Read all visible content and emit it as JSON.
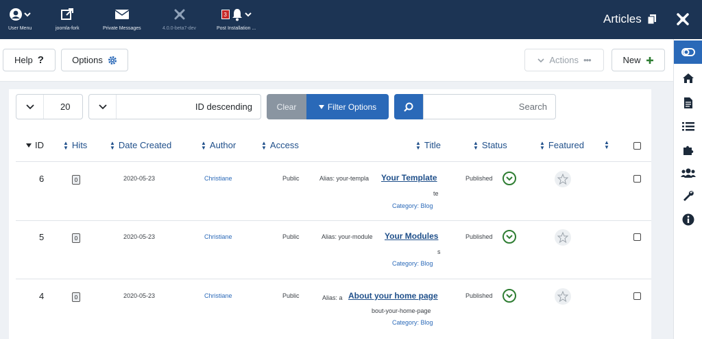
{
  "header": {
    "brand_title": "Articles",
    "items": [
      {
        "label": "User Menu",
        "icon": "user-icon"
      },
      {
        "label": "joomla-fork",
        "icon": "external-link-icon"
      },
      {
        "label": "Private Messages",
        "icon": "envelope-icon"
      },
      {
        "label": "4.0.0-beta7-dev",
        "icon": "joomla-icon"
      },
      {
        "label": "Post Installation ...",
        "icon": "bell-icon",
        "badge": "3"
      }
    ]
  },
  "sidebar": {
    "items": [
      {
        "name": "toggle-menu",
        "icon": "toggle-icon"
      },
      {
        "name": "home",
        "icon": "home-icon"
      },
      {
        "name": "content",
        "icon": "file-icon"
      },
      {
        "name": "menus",
        "icon": "list-icon"
      },
      {
        "name": "components",
        "icon": "puzzle-icon"
      },
      {
        "name": "users",
        "icon": "users-icon"
      },
      {
        "name": "system",
        "icon": "wrench-icon"
      },
      {
        "name": "help-info",
        "icon": "info-icon"
      }
    ]
  },
  "toolbar": {
    "new_label": "New",
    "actions_label": "Actions",
    "options_label": "Options",
    "help_label": "Help"
  },
  "filters": {
    "search_placeholder": "Search",
    "filter_options_label": "Filter Options",
    "clear_label": "Clear",
    "ordering_value": "ID descending",
    "limit_value": "20"
  },
  "table": {
    "headers": {
      "featured": "Featured",
      "status": "Status",
      "title": "Title",
      "access": "Access",
      "author": "Author",
      "date_created": "Date Created",
      "hits": "Hits",
      "id": "ID"
    },
    "rows": [
      {
        "status": "Published",
        "title": "Your Template",
        "alias_line1": "Alias: your-templa",
        "alias_line2": "te",
        "category": "Category: Blog",
        "access": "Public",
        "author": "Christiane",
        "date": "2020-05-23",
        "hits": "0",
        "id": "6"
      },
      {
        "status": "Published",
        "title": "Your Modules",
        "alias_line1": "Alias: your-module",
        "alias_line2": "s",
        "category": "Category: Blog",
        "access": "Public",
        "author": "Christiane",
        "date": "2020-05-23",
        "hits": "0",
        "id": "5"
      },
      {
        "status": "Published",
        "title": "About your home page",
        "alias_line1": "Alias: a",
        "alias_line2": "bout-your-home-page",
        "category": "Category: Blog",
        "access": "Public",
        "author": "Christiane",
        "date": "2020-05-23",
        "hits": "0",
        "id": "4"
      }
    ]
  },
  "colors": {
    "header_bg": "#1c3454",
    "primary": "#2a69b8",
    "published_green": "#2e7d32"
  }
}
